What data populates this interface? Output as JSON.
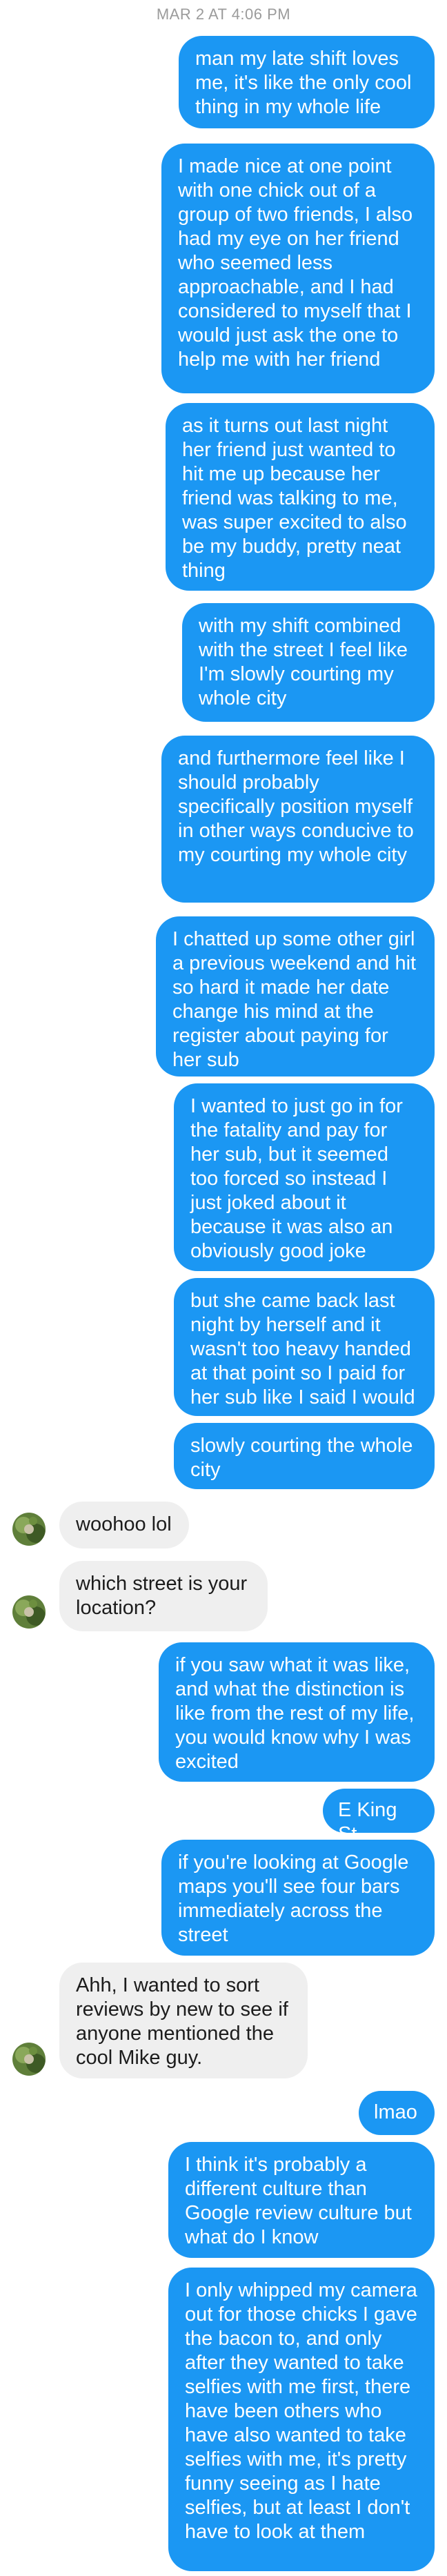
{
  "timestamp": "MAR 2 AT 4:06 PM",
  "messages": [
    {
      "from": "me",
      "text": "man my late shift loves me, it's like the only cool thing in my whole life"
    },
    {
      "from": "me",
      "text": "I made nice at one point with one chick out of a group of two friends, I also had my eye on her friend who seemed less approachable, and I had considered to myself that I would just ask the one to help me with her friend"
    },
    {
      "from": "me",
      "text": "as it turns out last night her friend just wanted to hit me up  because her friend was talking to me, was super excited to also be my buddy, pretty neat thing"
    },
    {
      "from": "me",
      "text": "with my shift combined with the street I feel like I'm slowly courting my whole city"
    },
    {
      "from": "me",
      "text": "and furthermore feel like I should probably specifically position myself in other ways conducive to my courting my whole city"
    },
    {
      "from": "me",
      "text": "I chatted up some other girl a previous weekend and hit so hard it made her date change his mind at the register about paying for her sub"
    },
    {
      "from": "me",
      "text": "I wanted to just go in for the fatality and pay for her sub, but it seemed too forced so instead I just joked about it because it was also an obviously good joke"
    },
    {
      "from": "me",
      "text": "but she came back last night by herself and it wasn't too heavy handed at that point so I paid for her sub like I said I would"
    },
    {
      "from": "me",
      "text": "slowly courting the whole city"
    },
    {
      "from": "them",
      "text": "woohoo lol"
    },
    {
      "from": "them",
      "text": "which street is your location?"
    },
    {
      "from": "me",
      "text": "if you saw what it was like, and what the distinction is like from the rest of my life, you would know why I was excited"
    },
    {
      "from": "me",
      "text": "E King St"
    },
    {
      "from": "me",
      "text": "if you're looking at Google maps you'll see four bars immediately across the street"
    },
    {
      "from": "them",
      "text": "Ahh, I wanted to sort reviews by new to see if anyone mentioned the cool Mike guy."
    },
    {
      "from": "me",
      "text": "lmao"
    },
    {
      "from": "me",
      "text": "I think it's probably a different culture than Google review culture but what do I know"
    },
    {
      "from": "me",
      "text": "I only whipped my camera out for those chicks I gave the bacon to, and only after they wanted to take selfies with me first, there have been others who have also wanted to take selfies with me, it's pretty funny seeing as I hate selfies, but at least I don't have to look at them"
    }
  ]
}
